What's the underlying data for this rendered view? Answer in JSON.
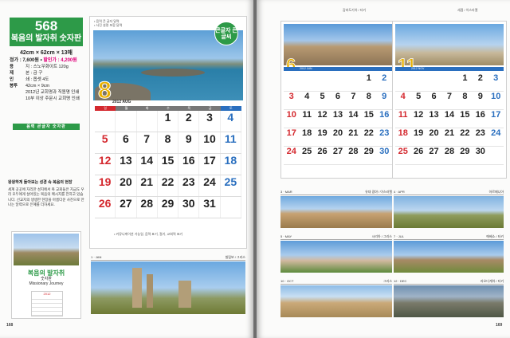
{
  "left_page": {
    "product": {
      "number": "568",
      "name": "복음의 발자취 숫자판"
    },
    "specs": {
      "size": "42cm × 62cm × 13매",
      "price_label": "정가 : 7,600원 • ",
      "price_discount": "할인가 : 4,200원",
      "rows": [
        {
          "k": "용",
          "v": "지 : 스노우화이트 120g"
        },
        {
          "k": "제",
          "v": "본 : 금 구"
        },
        {
          "k": "인",
          "v": "쇄 : 옵셋 4도"
        },
        {
          "k": "봉투",
          "v": "42cm × 9cm"
        }
      ],
      "notes": [
        "2012년 교회명과 직원명 인쇄",
        "10부 이상 주문시 교회명 인쇄"
      ]
    },
    "tag": "음력 큰글자 숫자판",
    "description": {
      "title": "왕왕하게 돌아보는 성경 속 복음의 현장",
      "body": "세계 곳곳에 자리한 성지에서 복 교회들은 지금도 우리 모두에게 살아있는 복음의 메시지를 전하고 있습니다. 선교지의 생생한 현장을 아름다운 사진으로 만나는 달력으로 은혜를 더하세요."
    },
    "cover": {
      "title": "복음의 발자취",
      "subtitle": "숫자판",
      "subtitle2": "Missionary Journey",
      "year": "2012"
    },
    "page_number": "168"
  },
  "main_calendar": {
    "notes": [
      "• 음력 큰 글자 달력",
      "• 사진 설명 포함 달력"
    ],
    "badge": "큰글자 큰글씨",
    "month": "8",
    "month_label": "2012 AUG",
    "weekdays": [
      "일",
      "월",
      "화",
      "수",
      "목",
      "금",
      "토"
    ],
    "weeks": [
      [
        "",
        "",
        "",
        "1",
        "2",
        "3",
        "4"
      ],
      [
        "5",
        "6",
        "7",
        "8",
        "9",
        "10",
        "11"
      ],
      [
        "12",
        "13",
        "14",
        "15",
        "16",
        "17",
        "18"
      ],
      [
        "19",
        "20",
        "21",
        "22",
        "23",
        "24",
        "25"
      ],
      [
        "26",
        "27",
        "28",
        "29",
        "30",
        "31",
        ""
      ]
    ],
    "footer": "• 커뮤니케이션 가능일, 음력 표기, 절기, 교회력 표기"
  },
  "strips": [
    {
      "label": "1 · JAN",
      "caption": "빌립보 / 그리스"
    },
    {
      "label": "3 · MAR",
      "caption": "유대 광야 / 이스라엘"
    },
    {
      "label": "4 · APR",
      "caption": "아르메니아"
    },
    {
      "label": "5 · MAY",
      "caption": "시리아 / 그리스"
    },
    {
      "label": "7 · JUL",
      "caption": "에베소 / 터키"
    },
    {
      "label": "10 · OCT",
      "caption": "그리스"
    },
    {
      "label": "12 · DEC",
      "caption": "라오디게아 / 터키"
    }
  ],
  "right_page": {
    "cal_left": {
      "top": "갑바도기아 / 터키",
      "month": "6",
      "bar": "2012 JUN",
      "weeks": [
        [
          "",
          "",
          "",
          "",
          "",
          "1",
          "2"
        ],
        [
          "3",
          "4",
          "5",
          "6",
          "7",
          "8",
          "9"
        ],
        [
          "10",
          "11",
          "12",
          "13",
          "14",
          "15",
          "16"
        ],
        [
          "17",
          "18",
          "19",
          "20",
          "21",
          "22",
          "23"
        ],
        [
          "24",
          "25",
          "26",
          "27",
          "28",
          "29",
          "30"
        ]
      ]
    },
    "cal_right": {
      "top": "세겜 / 이스라엘",
      "month": "11",
      "bar": "2012 NOV",
      "weeks": [
        [
          "",
          "",
          "",
          "",
          "1",
          "2",
          "3"
        ],
        [
          "4",
          "5",
          "6",
          "7",
          "8",
          "9",
          "10"
        ],
        [
          "11",
          "12",
          "13",
          "14",
          "15",
          "16",
          "17"
        ],
        [
          "18",
          "19",
          "20",
          "21",
          "22",
          "23",
          "24"
        ],
        [
          "25",
          "26",
          "27",
          "28",
          "29",
          "30",
          ""
        ]
      ]
    },
    "page_number": "169"
  },
  "colors": {
    "accent_green": "#2d9a48",
    "sunday_red": "#d4282e",
    "saturday_blue": "#2a6fbf",
    "month_gold": "#e8b000"
  }
}
